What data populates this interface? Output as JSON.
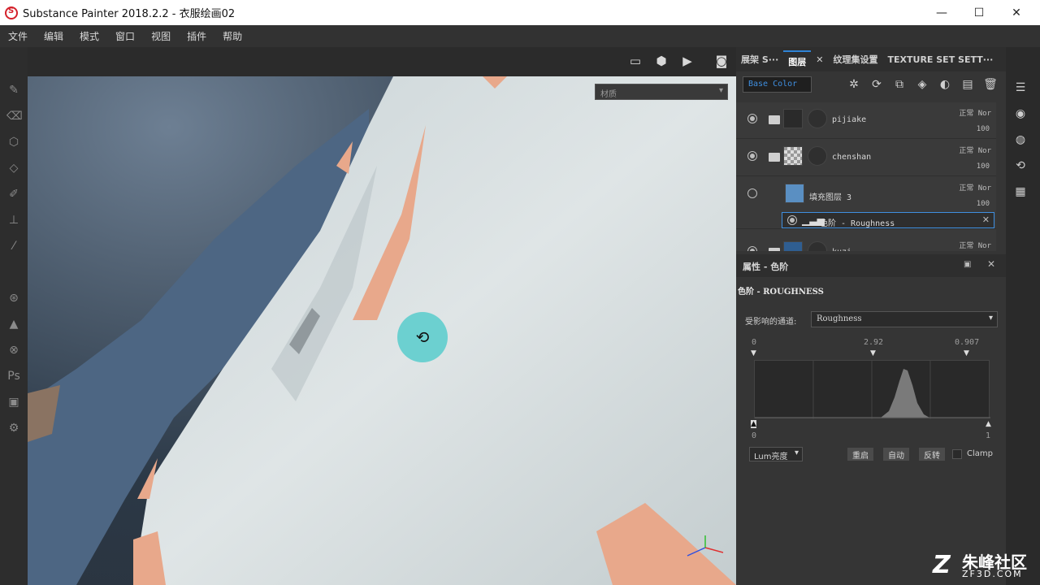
{
  "window": {
    "title": "Substance Painter 2018.2.2 - 衣服绘画02",
    "minimize": "—",
    "maximize": "☐",
    "close": "✕"
  },
  "menu": [
    "文件",
    "编辑",
    "模式",
    "窗口",
    "视图",
    "插件",
    "帮助"
  ],
  "viewport": {
    "material_select": "材质"
  },
  "panel": {
    "tabs": [
      "展架 S···",
      "图层",
      "纹理集设置",
      "TEXTURE SET SETT···"
    ],
    "channel": "Base Color",
    "layers": [
      {
        "name": "pijiake",
        "blend": "正常 Nor",
        "opacity": "100",
        "visible": true
      },
      {
        "name": "chenshan",
        "blend": "正常 Nor",
        "opacity": "100",
        "visible": true
      },
      {
        "name": "填充图层 3",
        "blend": "正常 Nor",
        "opacity": "100",
        "visible": false
      },
      {
        "name": "kuzi",
        "blend": "正常 Nor",
        "opacity": "",
        "visible": true
      }
    ],
    "sub_effect": "色阶 - Roughness"
  },
  "properties": {
    "header": "属性 - 色阶",
    "section": "色阶 - ROUGHNESS",
    "affected_label": "受影响的通道:",
    "affected_value": "Roughness",
    "input_low": "0",
    "input_mid": "2.92",
    "input_high": "0.907",
    "output_low": "0",
    "output_high": "1",
    "mode": "Lum亮度",
    "btn_reset": "重启",
    "btn_auto": "自动",
    "btn_invert": "反转",
    "clamp": "Clamp"
  },
  "watermark": {
    "main": "朱峰社区",
    "sub": "ZF3D.COM",
    "logo": "Z"
  },
  "colors": {
    "accent": "#2f83d6",
    "cursor": "#40c8c8"
  }
}
